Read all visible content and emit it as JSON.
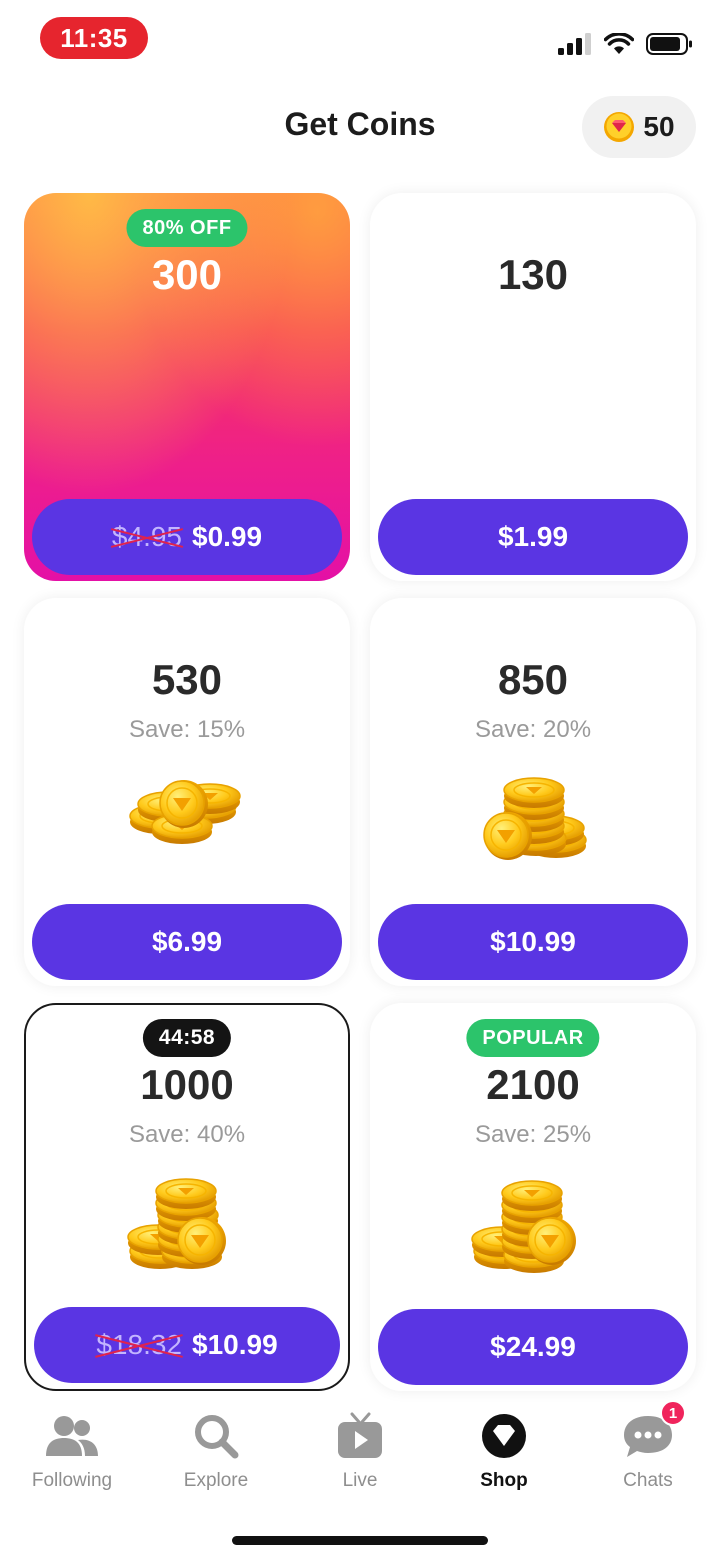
{
  "status_bar": {
    "time": "11:35"
  },
  "header": {
    "title": "Get Coins",
    "balance": "50"
  },
  "packages": [
    {
      "amount": "300",
      "badge": "80% OFF",
      "old_price": "$4.95",
      "price": "$0.99"
    },
    {
      "amount": "130",
      "price": "$1.99"
    },
    {
      "amount": "530",
      "save": "Save: 15%",
      "price": "$6.99"
    },
    {
      "amount": "850",
      "save": "Save: 20%",
      "price": "$10.99"
    },
    {
      "amount": "1000",
      "badge": "44:58",
      "save": "Save: 40%",
      "old_price": "$18.32",
      "price": "$10.99"
    },
    {
      "amount": "2100",
      "badge": "POPULAR",
      "save": "Save: 25%",
      "price": "$24.99"
    }
  ],
  "tabbar": {
    "tabs": [
      {
        "label": "Following",
        "icon": "people-icon"
      },
      {
        "label": "Explore",
        "icon": "search-icon"
      },
      {
        "label": "Live",
        "icon": "tv-play-icon"
      },
      {
        "label": "Shop",
        "icon": "diamond-icon",
        "active": true
      },
      {
        "label": "Chats",
        "icon": "chat-bubble-icon",
        "badge": "1"
      }
    ]
  },
  "colors": {
    "primary_button": "#5a35e3",
    "badge_green": "#2cc46b",
    "status_time_bg": "#e6252e",
    "notification": "#f0245c"
  }
}
